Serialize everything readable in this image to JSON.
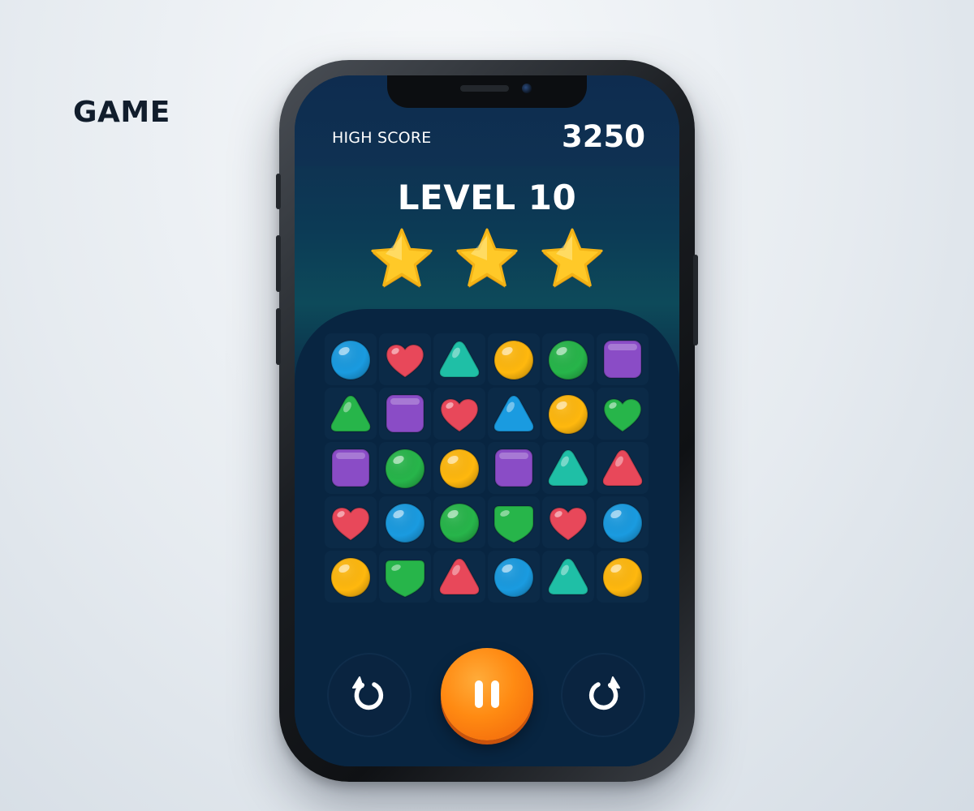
{
  "page_label": "GAME",
  "header": {
    "high_score_label": "HIGH SCORE",
    "high_score_value": "3250"
  },
  "level": {
    "title": "LEVEL 10",
    "stars_earned": 3,
    "stars_total": 3
  },
  "board": {
    "rows": 5,
    "cols": 6,
    "cells": [
      [
        "blue-circle",
        "red-heart",
        "teal-triangle",
        "yellow-circle",
        "green-circle",
        "purple-square"
      ],
      [
        "green-triangle",
        "purple-square",
        "red-heart",
        "blue-triangle",
        "yellow-circle",
        "green-heart"
      ],
      [
        "purple-square",
        "green-circle",
        "yellow-circle",
        "purple-square",
        "teal-triangle",
        "red-triangle"
      ],
      [
        "red-heart",
        "blue-circle",
        "green-circle",
        "green-shield",
        "red-heart",
        "blue-circle"
      ],
      [
        "yellow-circle",
        "green-shield",
        "red-triangle",
        "blue-circle",
        "teal-triangle",
        "yellow-circle"
      ]
    ]
  },
  "controls": {
    "undo_icon": "undo-icon",
    "pause_icon": "pause-icon",
    "redo_icon": "redo-icon"
  },
  "colors": {
    "accent": "#FF8A12",
    "star": "#FFC928",
    "blue": "#1A9BE0",
    "red": "#E8485A",
    "teal": "#1FBFA6",
    "yellow": "#FFB80E",
    "green": "#27B54A",
    "purple": "#8A4CC6"
  }
}
